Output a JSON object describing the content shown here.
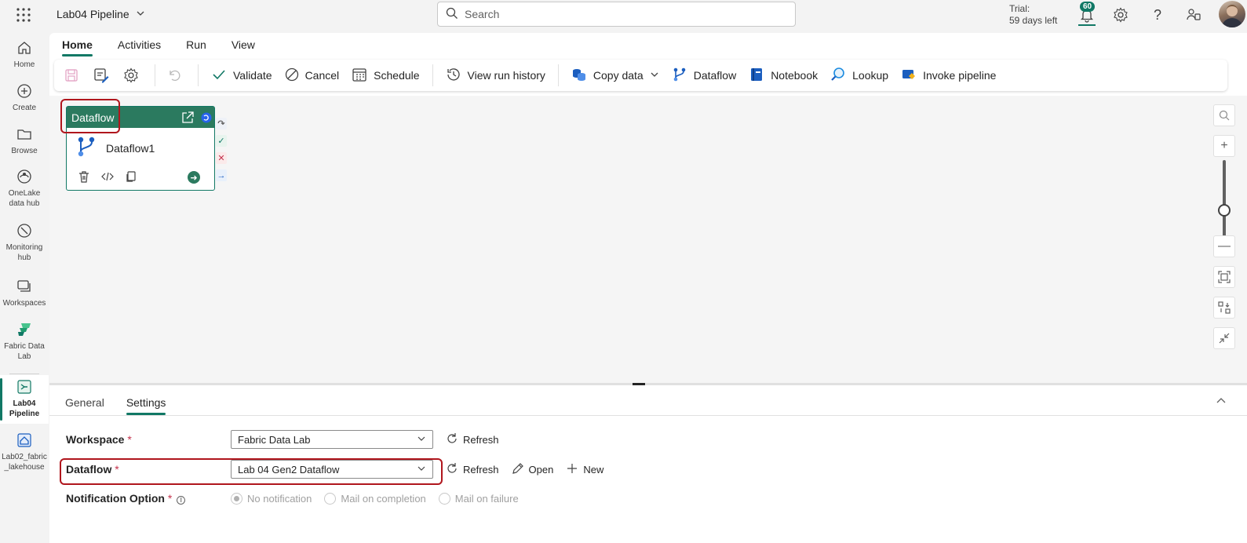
{
  "topbar": {
    "app_title": "Lab04 Pipeline",
    "search_placeholder": "Search",
    "trial_line1": "Trial:",
    "trial_line2": "59 days left",
    "notification_count": "60"
  },
  "rail": {
    "items": [
      {
        "label": "Home"
      },
      {
        "label": "Create"
      },
      {
        "label": "Browse"
      },
      {
        "label": "OneLake data hub"
      },
      {
        "label": "Monitoring hub"
      },
      {
        "label": "Workspaces"
      },
      {
        "label": "Fabric Data Lab"
      },
      {
        "label": "Lab04 Pipeline"
      },
      {
        "label": "Lab02_fabric_lakehouse"
      }
    ]
  },
  "ribbon": {
    "tabs": [
      "Home",
      "Activities",
      "Run",
      "View"
    ],
    "active_tab": "Home",
    "buttons": {
      "validate": "Validate",
      "cancel": "Cancel",
      "schedule": "Schedule",
      "view_run_history": "View run history",
      "copy_data": "Copy data",
      "dataflow": "Dataflow",
      "notebook": "Notebook",
      "lookup": "Lookup",
      "invoke_pipeline": "Invoke pipeline"
    }
  },
  "canvas": {
    "activity": {
      "type_label": "Dataflow",
      "name": "Dataflow1"
    }
  },
  "panel": {
    "tabs": [
      "General",
      "Settings"
    ],
    "active_tab": "Settings",
    "workspace": {
      "label": "Workspace",
      "value": "Fabric Data Lab",
      "refresh": "Refresh"
    },
    "dataflow": {
      "label": "Dataflow",
      "value": "Lab 04 Gen2 Dataflow",
      "refresh": "Refresh",
      "open": "Open",
      "new": "New"
    },
    "notification": {
      "label": "Notification Option",
      "options": [
        "No notification",
        "Mail on completion",
        "Mail on failure"
      ],
      "selected": "No notification"
    },
    "required_mark": "*"
  },
  "colors": {
    "accent": "#117865",
    "activity_header": "#2b7a5f",
    "highlight": "#b0161d"
  }
}
